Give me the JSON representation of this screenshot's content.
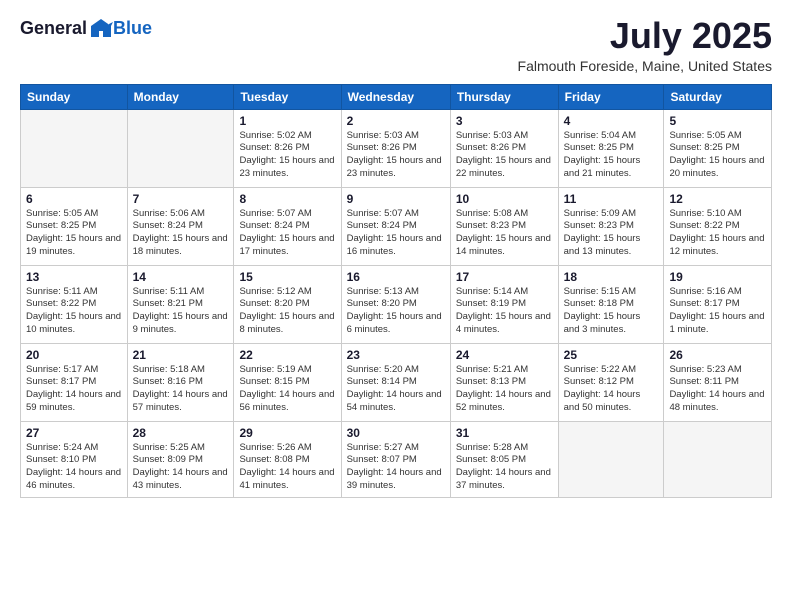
{
  "header": {
    "logo_general": "General",
    "logo_blue": "Blue",
    "month_year": "July 2025",
    "location": "Falmouth Foreside, Maine, United States"
  },
  "days_of_week": [
    "Sunday",
    "Monday",
    "Tuesday",
    "Wednesday",
    "Thursday",
    "Friday",
    "Saturday"
  ],
  "weeks": [
    [
      {
        "day": "",
        "empty": true
      },
      {
        "day": "",
        "empty": true
      },
      {
        "day": "1",
        "sunrise": "Sunrise: 5:02 AM",
        "sunset": "Sunset: 8:26 PM",
        "daylight": "Daylight: 15 hours and 23 minutes."
      },
      {
        "day": "2",
        "sunrise": "Sunrise: 5:03 AM",
        "sunset": "Sunset: 8:26 PM",
        "daylight": "Daylight: 15 hours and 23 minutes."
      },
      {
        "day": "3",
        "sunrise": "Sunrise: 5:03 AM",
        "sunset": "Sunset: 8:26 PM",
        "daylight": "Daylight: 15 hours and 22 minutes."
      },
      {
        "day": "4",
        "sunrise": "Sunrise: 5:04 AM",
        "sunset": "Sunset: 8:25 PM",
        "daylight": "Daylight: 15 hours and 21 minutes."
      },
      {
        "day": "5",
        "sunrise": "Sunrise: 5:05 AM",
        "sunset": "Sunset: 8:25 PM",
        "daylight": "Daylight: 15 hours and 20 minutes."
      }
    ],
    [
      {
        "day": "6",
        "sunrise": "Sunrise: 5:05 AM",
        "sunset": "Sunset: 8:25 PM",
        "daylight": "Daylight: 15 hours and 19 minutes."
      },
      {
        "day": "7",
        "sunrise": "Sunrise: 5:06 AM",
        "sunset": "Sunset: 8:24 PM",
        "daylight": "Daylight: 15 hours and 18 minutes."
      },
      {
        "day": "8",
        "sunrise": "Sunrise: 5:07 AM",
        "sunset": "Sunset: 8:24 PM",
        "daylight": "Daylight: 15 hours and 17 minutes."
      },
      {
        "day": "9",
        "sunrise": "Sunrise: 5:07 AM",
        "sunset": "Sunset: 8:24 PM",
        "daylight": "Daylight: 15 hours and 16 minutes."
      },
      {
        "day": "10",
        "sunrise": "Sunrise: 5:08 AM",
        "sunset": "Sunset: 8:23 PM",
        "daylight": "Daylight: 15 hours and 14 minutes."
      },
      {
        "day": "11",
        "sunrise": "Sunrise: 5:09 AM",
        "sunset": "Sunset: 8:23 PM",
        "daylight": "Daylight: 15 hours and 13 minutes."
      },
      {
        "day": "12",
        "sunrise": "Sunrise: 5:10 AM",
        "sunset": "Sunset: 8:22 PM",
        "daylight": "Daylight: 15 hours and 12 minutes."
      }
    ],
    [
      {
        "day": "13",
        "sunrise": "Sunrise: 5:11 AM",
        "sunset": "Sunset: 8:22 PM",
        "daylight": "Daylight: 15 hours and 10 minutes."
      },
      {
        "day": "14",
        "sunrise": "Sunrise: 5:11 AM",
        "sunset": "Sunset: 8:21 PM",
        "daylight": "Daylight: 15 hours and 9 minutes."
      },
      {
        "day": "15",
        "sunrise": "Sunrise: 5:12 AM",
        "sunset": "Sunset: 8:20 PM",
        "daylight": "Daylight: 15 hours and 8 minutes."
      },
      {
        "day": "16",
        "sunrise": "Sunrise: 5:13 AM",
        "sunset": "Sunset: 8:20 PM",
        "daylight": "Daylight: 15 hours and 6 minutes."
      },
      {
        "day": "17",
        "sunrise": "Sunrise: 5:14 AM",
        "sunset": "Sunset: 8:19 PM",
        "daylight": "Daylight: 15 hours and 4 minutes."
      },
      {
        "day": "18",
        "sunrise": "Sunrise: 5:15 AM",
        "sunset": "Sunset: 8:18 PM",
        "daylight": "Daylight: 15 hours and 3 minutes."
      },
      {
        "day": "19",
        "sunrise": "Sunrise: 5:16 AM",
        "sunset": "Sunset: 8:17 PM",
        "daylight": "Daylight: 15 hours and 1 minute."
      }
    ],
    [
      {
        "day": "20",
        "sunrise": "Sunrise: 5:17 AM",
        "sunset": "Sunset: 8:17 PM",
        "daylight": "Daylight: 14 hours and 59 minutes."
      },
      {
        "day": "21",
        "sunrise": "Sunrise: 5:18 AM",
        "sunset": "Sunset: 8:16 PM",
        "daylight": "Daylight: 14 hours and 57 minutes."
      },
      {
        "day": "22",
        "sunrise": "Sunrise: 5:19 AM",
        "sunset": "Sunset: 8:15 PM",
        "daylight": "Daylight: 14 hours and 56 minutes."
      },
      {
        "day": "23",
        "sunrise": "Sunrise: 5:20 AM",
        "sunset": "Sunset: 8:14 PM",
        "daylight": "Daylight: 14 hours and 54 minutes."
      },
      {
        "day": "24",
        "sunrise": "Sunrise: 5:21 AM",
        "sunset": "Sunset: 8:13 PM",
        "daylight": "Daylight: 14 hours and 52 minutes."
      },
      {
        "day": "25",
        "sunrise": "Sunrise: 5:22 AM",
        "sunset": "Sunset: 8:12 PM",
        "daylight": "Daylight: 14 hours and 50 minutes."
      },
      {
        "day": "26",
        "sunrise": "Sunrise: 5:23 AM",
        "sunset": "Sunset: 8:11 PM",
        "daylight": "Daylight: 14 hours and 48 minutes."
      }
    ],
    [
      {
        "day": "27",
        "sunrise": "Sunrise: 5:24 AM",
        "sunset": "Sunset: 8:10 PM",
        "daylight": "Daylight: 14 hours and 46 minutes."
      },
      {
        "day": "28",
        "sunrise": "Sunrise: 5:25 AM",
        "sunset": "Sunset: 8:09 PM",
        "daylight": "Daylight: 14 hours and 43 minutes."
      },
      {
        "day": "29",
        "sunrise": "Sunrise: 5:26 AM",
        "sunset": "Sunset: 8:08 PM",
        "daylight": "Daylight: 14 hours and 41 minutes."
      },
      {
        "day": "30",
        "sunrise": "Sunrise: 5:27 AM",
        "sunset": "Sunset: 8:07 PM",
        "daylight": "Daylight: 14 hours and 39 minutes."
      },
      {
        "day": "31",
        "sunrise": "Sunrise: 5:28 AM",
        "sunset": "Sunset: 8:05 PM",
        "daylight": "Daylight: 14 hours and 37 minutes."
      },
      {
        "day": "",
        "empty": true
      },
      {
        "day": "",
        "empty": true
      }
    ]
  ]
}
